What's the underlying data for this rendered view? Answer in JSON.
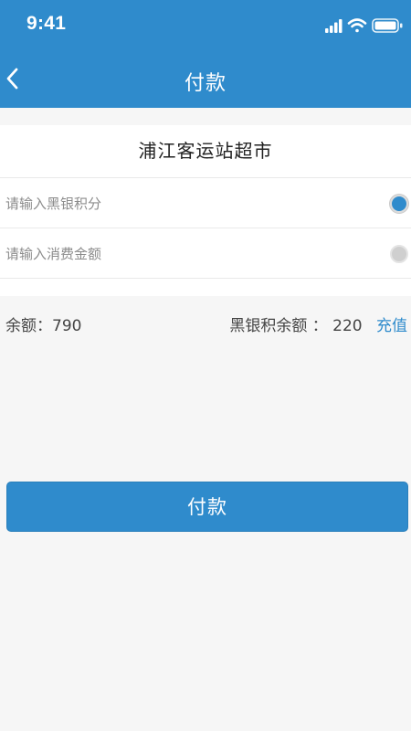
{
  "status_bar": {
    "time": "9:41",
    "icons": [
      "signal-icon",
      "wifi-icon",
      "battery-icon"
    ]
  },
  "nav": {
    "title": "付款",
    "back_icon": "chevron-left-icon"
  },
  "form": {
    "merchant_name": "浦江客运站超市",
    "points_field": {
      "placeholder": "请输入黑银积分",
      "value": "",
      "selected": true
    },
    "amount_field": {
      "placeholder": "请输入消费金额",
      "value": "",
      "selected": false
    }
  },
  "balance": {
    "label": "余额：",
    "value": "790",
    "points_label": "黑银积余额 ：",
    "points_value": "220",
    "recharge_label": "充值"
  },
  "pay_button": {
    "label": "付款"
  },
  "colors": {
    "primary": "#2f8bcc",
    "background": "#f6f6f6",
    "card": "#ffffff",
    "radio_off": "#cfcfcf"
  }
}
